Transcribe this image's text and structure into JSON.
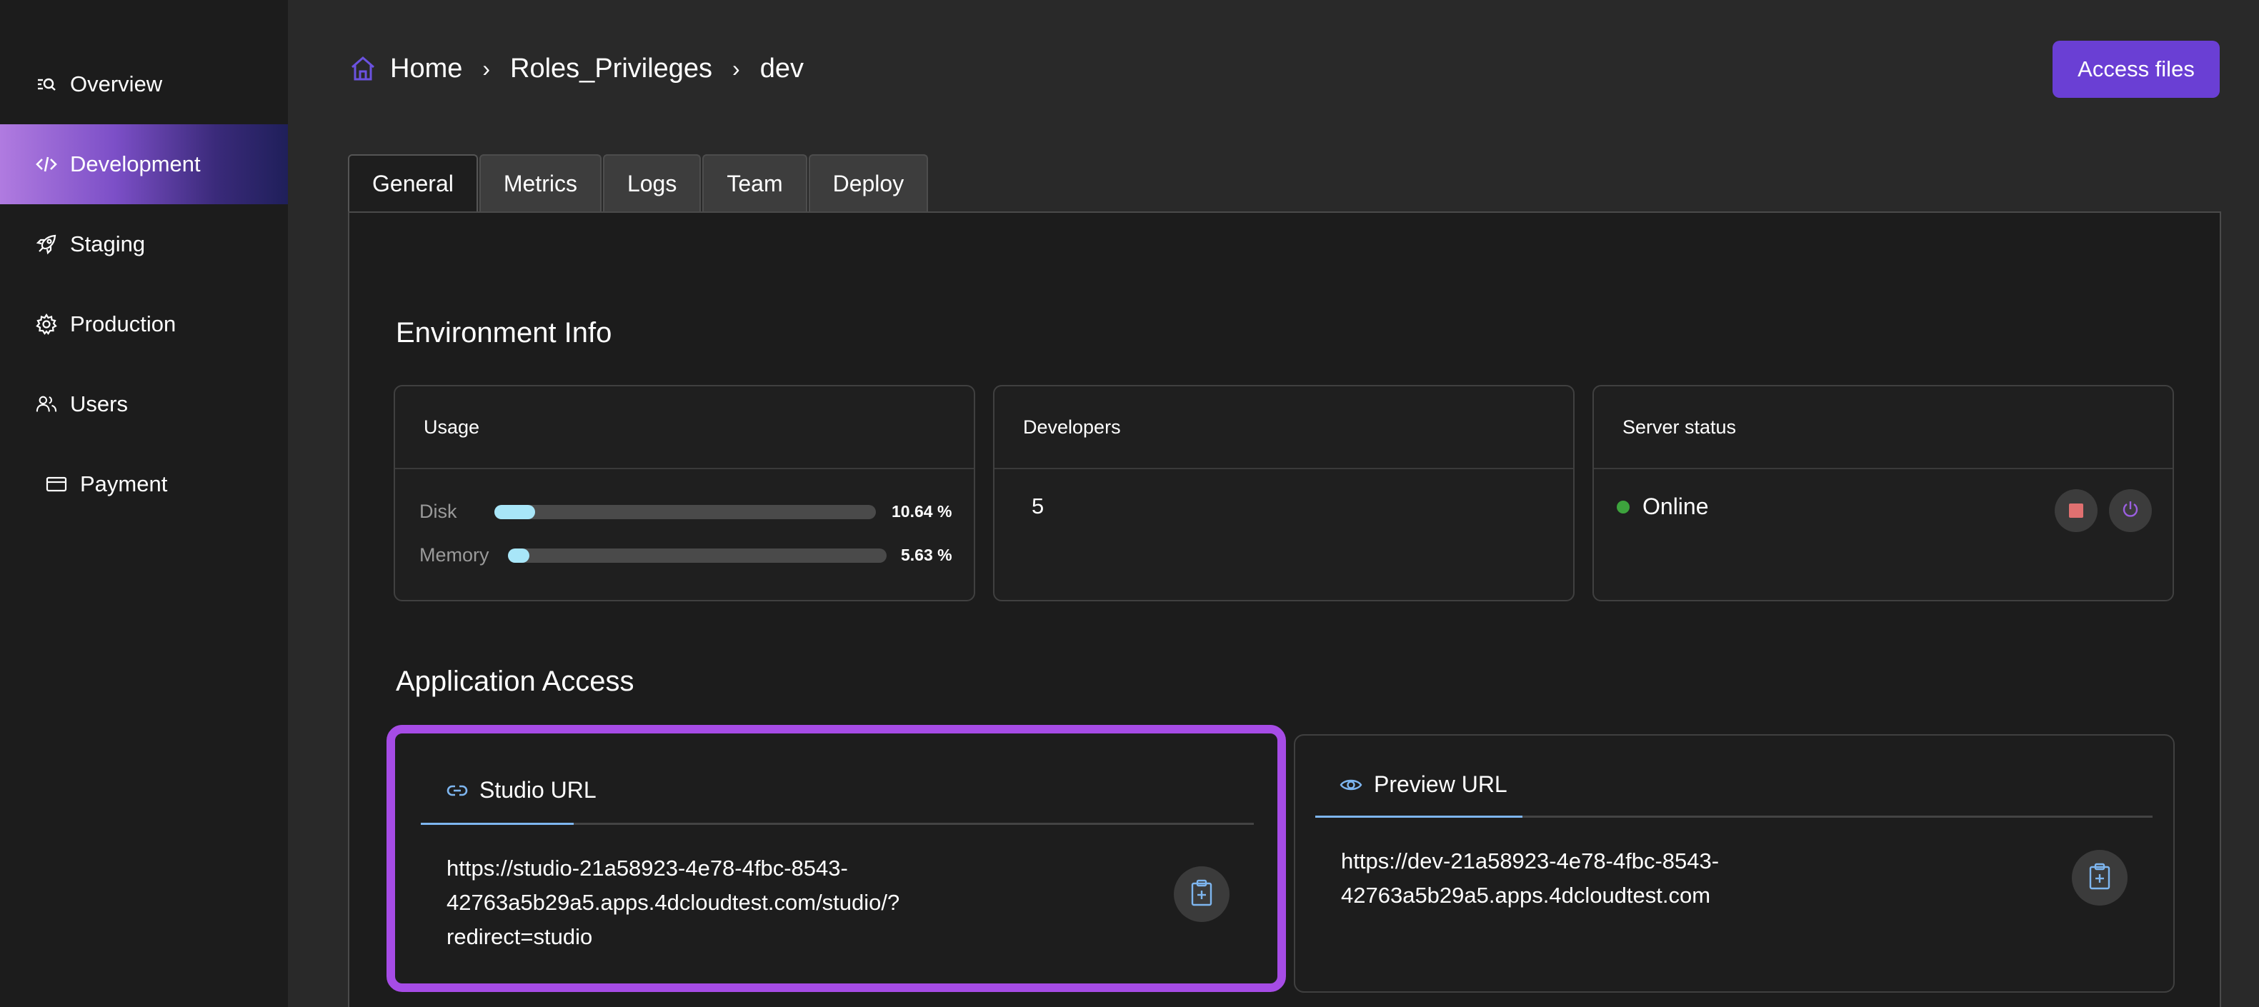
{
  "sidebar": {
    "items": [
      {
        "label": "Overview",
        "icon": "overview-icon"
      },
      {
        "label": "Development",
        "icon": "code-icon",
        "active": true
      },
      {
        "label": "Staging",
        "icon": "rocket-icon"
      },
      {
        "label": "Production",
        "icon": "gear-icon"
      },
      {
        "label": "Users",
        "icon": "users-icon"
      },
      {
        "label": "Payment",
        "icon": "card-icon"
      }
    ]
  },
  "header": {
    "breadcrumb": [
      "Home",
      "Roles_Privileges",
      "dev"
    ],
    "access_button": "Access files"
  },
  "tabs": [
    "General",
    "Metrics",
    "Logs",
    "Team",
    "Deploy"
  ],
  "environment": {
    "title": "Environment Info",
    "usage": {
      "title": "Usage",
      "disk_label": "Disk",
      "disk_value": "10.64 %",
      "disk_percent": 10.64,
      "memory_label": "Memory",
      "memory_value": "5.63 %",
      "memory_percent": 5.63
    },
    "developers": {
      "title": "Developers",
      "count": "5"
    },
    "server": {
      "title": "Server status",
      "status": "Online"
    }
  },
  "access": {
    "title": "Application Access",
    "studio": {
      "label": "Studio URL",
      "url_line1": "https://studio-21a58923-4e78-4fbc-8543-",
      "url_line2": "42763a5b29a5.apps.4dcloudtest.com/studio/?",
      "url_line3": "redirect=studio"
    },
    "preview": {
      "label": "Preview URL",
      "url_line1": "https://dev-21a58923-4e78-4fbc-8543-",
      "url_line2": "42763a5b29a5.apps.4dcloudtest.com"
    }
  },
  "colors": {
    "accent": "#6a3fd4",
    "highlight": "#a64ce6",
    "online": "#3da33d",
    "bar": "#a8e6f8"
  }
}
